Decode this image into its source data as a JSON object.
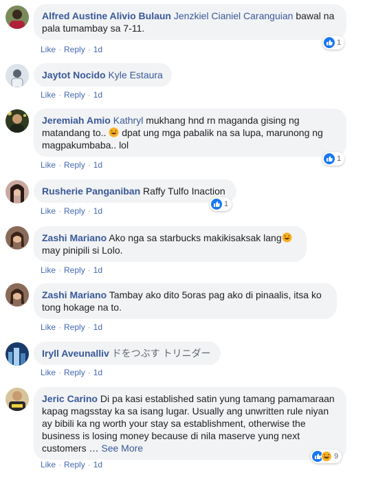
{
  "actions": {
    "like": "Like",
    "reply": "Reply",
    "sep": "·"
  },
  "comments": [
    {
      "author": "Alfred Austine Alivio Bulaun",
      "mention": "Jenzkiel Cianiel Caranguian",
      "text": "bawal na pala tumambay sa 7-11.",
      "time": "1d",
      "reaction_count": "1",
      "avatar_icon": "person-icon"
    },
    {
      "author": "Jaytot Nocido",
      "mention": "Kyle Estaura",
      "text": "",
      "time": "1d",
      "avatar_icon": "person-icon"
    },
    {
      "author": "Jeremiah Amio",
      "mention": "Kathryl",
      "text_line1": "mukhang hnd rn maganda gising ng",
      "text_line2a": "matandang to..",
      "text_line2b": "dpat ung mga pabalik na sa lupa, marunong ng",
      "text_line3": "magpakumbaba.. lol",
      "time": "1d",
      "reaction_count": "1",
      "avatar_icon": "person-icon"
    },
    {
      "author": "Rusherie Panganiban",
      "mention": "",
      "text": "Raffy Tulfo Inaction",
      "time": "1d",
      "reaction_count": "1",
      "avatar_icon": "person-icon"
    },
    {
      "author": "Zashi Mariano",
      "text_line1": "Ako nga sa starbucks makikisaksak lang",
      "text_line2": "may pinipili si Lolo.",
      "time": "1d",
      "avatar_icon": "person-icon"
    },
    {
      "author": "Zashi Mariano",
      "text_line1": "Tambay ako dito 5oras pag ako di pinaalis, itsa ko",
      "text_line2": "tong hokage na to.",
      "time": "1d",
      "avatar_icon": "person-icon"
    },
    {
      "author": "Iryll Aveunalliv",
      "text": "ドをつぶす トリニダー",
      "time": "1d",
      "avatar_icon": "person-icon"
    },
    {
      "author": "Jeric Carino",
      "text_line1": "Di pa kasi established satin yung tamang pamamaraan",
      "text_line2": "kapag magsstay ka sa isang lugar. Usually ang unwritten rule niyan",
      "text_line3": "ay bibili ka ng worth your stay sa establishment, otherwise the",
      "text_line4": "business is losing money because di nila maserve yung next",
      "text_line5": "customers …",
      "see_more": "See More",
      "time": "1d",
      "reaction_count": "9",
      "avatar_icon": "person-icon"
    }
  ],
  "colors": {
    "link": "#385898",
    "bubble": "#f2f3f5",
    "meta": "#90949c",
    "action": "#4267b2",
    "like_blue": "#1877f2",
    "haha_yellow": "#f7b125"
  }
}
